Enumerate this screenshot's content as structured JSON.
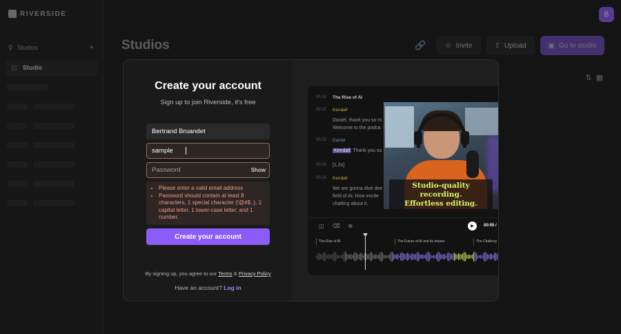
{
  "app": {
    "logo_text": "RIVERSIDE",
    "avatar_initial": "B"
  },
  "sidebar": {
    "search_label": "Studios",
    "studio_label": "Studio"
  },
  "header": {
    "title": "Studios",
    "invite_label": "Invite",
    "upload_label": "Upload",
    "go_to_studio_label": "Go to studio"
  },
  "modal": {
    "title": "Create your account",
    "subtitle": "Sign up to join Riverside, it's free",
    "name_value": "Bertrand Bruandet",
    "email_value": "sample",
    "password_placeholder": "Password",
    "show_label": "Show",
    "errors": [
      "Please enter a valid email address",
      "Password should contain at least 8 characters, 1 special character (!@#$..), 1 capital letter, 1 lower-case letter, and 1 number."
    ],
    "submit_label": "Create your account",
    "terms_prefix": "By signing up, you agree to our",
    "terms_link": "Terms",
    "terms_and": "&",
    "privacy_link": "Privacy Policy",
    "login_prompt": "Have an account?",
    "login_link": "Log in"
  },
  "preview": {
    "transcript": {
      "heading": "The Rise of AI",
      "speaker1": "Kendall",
      "line1a": "Daniel, thank you so m",
      "line1b": "Welcome to the podca",
      "speaker2": "Daniel",
      "highlight": "Kendall",
      "line2": "Thank you so",
      "pause": "[1.2s]",
      "speaker3": "Kendall",
      "line3a": "We are gonna dive dee",
      "line3b": "field of AI. How excite",
      "line3c": "chatting about it."
    },
    "caption_line1": "Studio-quality recording.",
    "caption_line2": "Effortless editing.",
    "timecode": "00:05 /",
    "chapters": [
      "The Rise of AI",
      "The Future of AI and its Impact",
      "The Challeng"
    ],
    "accent_color": "#8b5cf6",
    "caption_color": "#d9f86b"
  }
}
